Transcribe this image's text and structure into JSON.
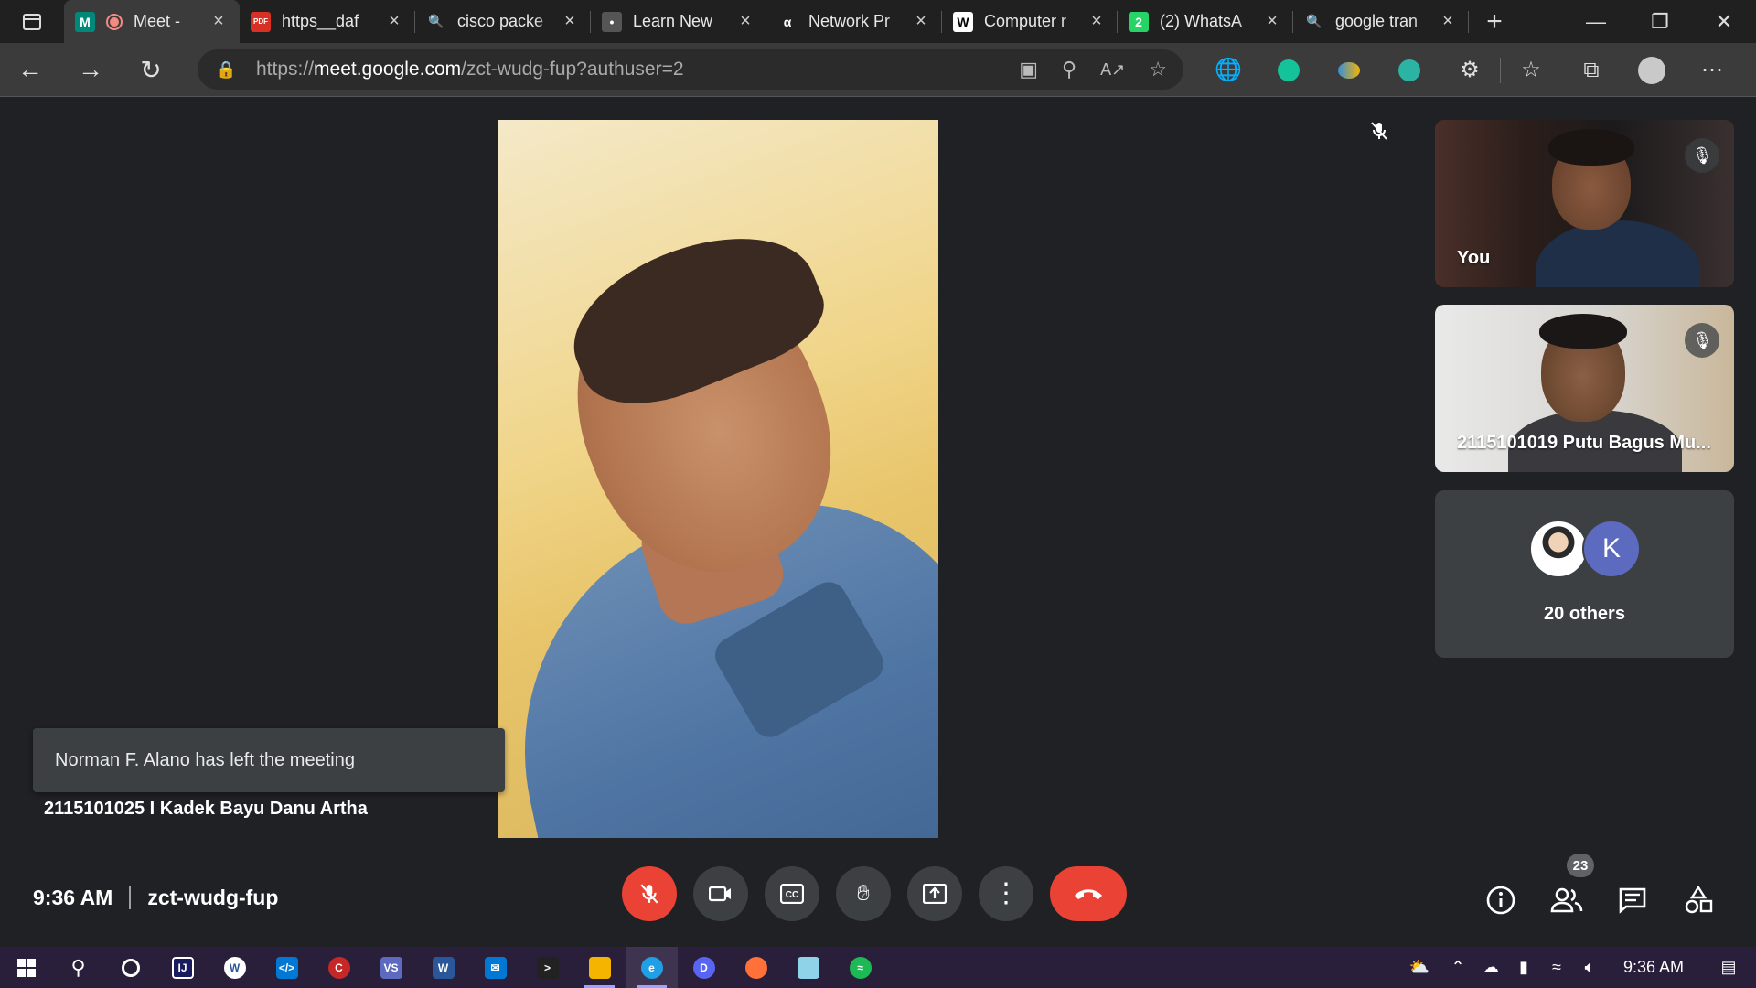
{
  "browser": {
    "tabs": [
      {
        "title": "Meet -",
        "favicon": "M",
        "favicon_color": "#00897b",
        "active": true,
        "recording": true
      },
      {
        "title": "https__daf",
        "favicon": "PDF",
        "favicon_color": "#d93025"
      },
      {
        "title": "cisco packe",
        "favicon": "🔍",
        "favicon_color": "transparent"
      },
      {
        "title": "Learn New",
        "favicon": "•",
        "favicon_color": "#555555"
      },
      {
        "title": "Network Pr",
        "favicon": "α",
        "favicon_color": "transparent"
      },
      {
        "title": "Computer r",
        "favicon": "W",
        "favicon_color": "#ffffff"
      },
      {
        "title": "(2) WhatsA",
        "favicon": "2",
        "favicon_color": "#25d366"
      },
      {
        "title": "google tran",
        "favicon": "🔍",
        "favicon_color": "transparent"
      }
    ],
    "url": {
      "prefix": "https://",
      "host": "meet.google.com",
      "path": "/zct-wudg-fup?authuser=2"
    }
  },
  "meet": {
    "main_participant_name": "2115101025 I Kadek Bayu Danu Artha",
    "toast": "Norman F. Alano has left the meeting",
    "tiles": {
      "you": {
        "name": "You"
      },
      "putu": {
        "name": "2115101019 Putu Bagus Mu..."
      },
      "others": {
        "label": "20 others",
        "avatar_letter": "K"
      }
    },
    "time": "9:36 AM",
    "meeting_code": "zct-wudg-fup",
    "people_count": "23",
    "accent": {
      "danger": "#ea4335",
      "avatar_k": "#5c6bc0"
    }
  },
  "taskbar": {
    "clock": "9:36 AM",
    "apps": [
      "windows-start",
      "search",
      "cortana",
      "jetbrains",
      "w-app",
      "vscode",
      "dev-cpp",
      "visual-studio",
      "word",
      "mail",
      "terminal",
      "file-explorer",
      "edge",
      "discord",
      "firefox",
      "notepad",
      "spotify"
    ]
  }
}
